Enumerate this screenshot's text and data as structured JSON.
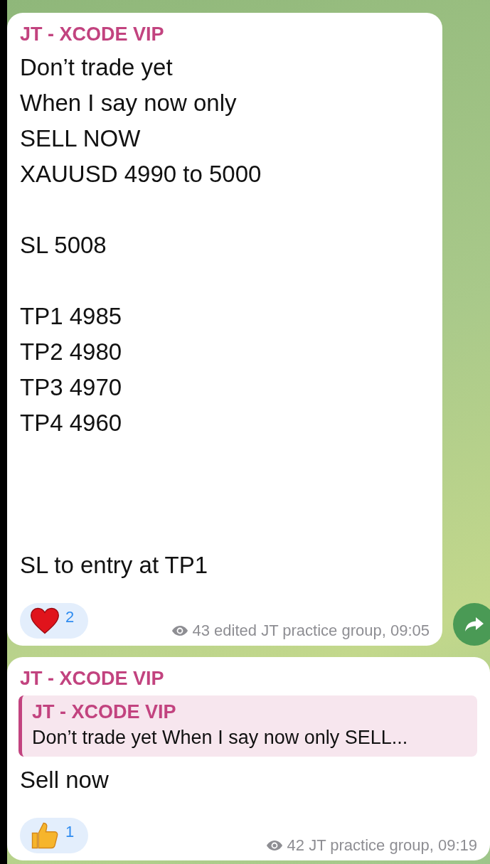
{
  "messages": [
    {
      "sender": "JT - XCODE VIP",
      "paragraphs": [
        [
          "Don’t trade yet",
          "When I say now only",
          "SELL NOW",
          "XAUUSD 4990 to 5000"
        ],
        [
          "SL 5008"
        ],
        [
          "TP1 4985",
          "TP2 4980",
          "TP3 4970",
          "TP4 4960"
        ],
        [
          "SL to entry at TP1"
        ]
      ],
      "reaction": {
        "kind": "heart",
        "count": "2"
      },
      "views": "43",
      "footer": "edited JT practice group, 09:05",
      "forward_button": true
    },
    {
      "sender": "JT - XCODE VIP",
      "reply": {
        "sender": "JT - XCODE VIP",
        "text": "Don’t trade yet When I say now only SELL..."
      },
      "paragraphs": [
        [
          "Sell now"
        ]
      ],
      "reaction": {
        "kind": "thumbs-up",
        "count": "1"
      },
      "views": "42",
      "footer": "JT practice group, 09:19",
      "forward_button": false
    }
  ]
}
